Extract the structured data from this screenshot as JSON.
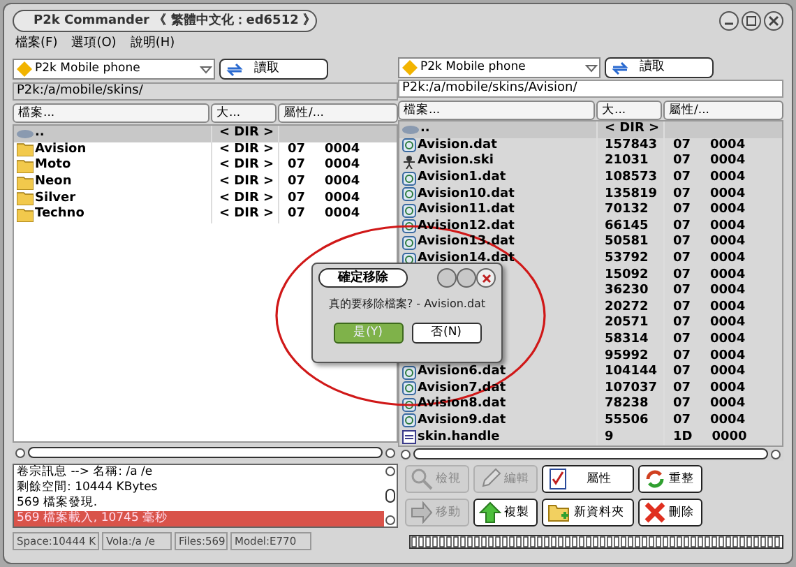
{
  "window": {
    "title": "P2k Commander 《 繁體中文化：ed6512 》"
  },
  "menu": [
    {
      "label": "檔案(F)"
    },
    {
      "label": "選項(O)"
    },
    {
      "label": "說明(H)"
    }
  ],
  "panels": [
    {
      "active": true,
      "device": "P2k Mobile phone",
      "read_button": "讀取",
      "path": "P2k:/a/mobile/skins/",
      "columns": [
        "檔案...",
        "大...",
        "屬性/..."
      ],
      "rows": [
        {
          "kind": "up",
          "name": "..",
          "size": "< DIR >"
        },
        {
          "kind": "folder",
          "name": "Avision",
          "size": "< DIR >",
          "attr": "07",
          "attr2": "0004"
        },
        {
          "kind": "folder",
          "name": "Moto",
          "size": "< DIR >",
          "attr": "07",
          "attr2": "0004"
        },
        {
          "kind": "folder",
          "name": "Neon",
          "size": "< DIR >",
          "attr": "07",
          "attr2": "0004"
        },
        {
          "kind": "folder",
          "name": "Silver",
          "size": "< DIR >",
          "attr": "07",
          "attr2": "0004"
        },
        {
          "kind": "folder",
          "name": "Techno",
          "size": "< DIR >",
          "attr": "07",
          "attr2": "0004"
        }
      ]
    },
    {
      "active": false,
      "device": "P2k Mobile phone",
      "read_button": "讀取",
      "path": "P2k:/a/mobile/skins/Avision/",
      "columns": [
        "檔案...",
        "大...",
        "屬性/..."
      ],
      "rows": [
        {
          "kind": "up",
          "name": "..",
          "size": "< DIR >"
        },
        {
          "kind": "dat",
          "name": "Avision.dat",
          "size": "157843",
          "attr": "07",
          "attr2": "0004"
        },
        {
          "kind": "ski",
          "name": "Avision.ski",
          "size": "21031",
          "attr": "07",
          "attr2": "0004"
        },
        {
          "kind": "dat",
          "name": "Avision1.dat",
          "size": "108573",
          "attr": "07",
          "attr2": "0004"
        },
        {
          "kind": "dat",
          "name": "Avision10.dat",
          "size": "135819",
          "attr": "07",
          "attr2": "0004"
        },
        {
          "kind": "dat",
          "name": "Avision11.dat",
          "size": "70132",
          "attr": "07",
          "attr2": "0004"
        },
        {
          "kind": "dat",
          "name": "Avision12.dat",
          "size": "66145",
          "attr": "07",
          "attr2": "0004"
        },
        {
          "kind": "dat",
          "name": "Avision13.dat",
          "size": "50581",
          "attr": "07",
          "attr2": "0004"
        },
        {
          "kind": "dat",
          "name": "Avision14.dat",
          "size": "53792",
          "attr": "07",
          "attr2": "0004"
        },
        {
          "kind": "hidden",
          "size": "15092",
          "attr": "07",
          "attr2": "0004"
        },
        {
          "kind": "hidden",
          "size": "36230",
          "attr": "07",
          "attr2": "0004"
        },
        {
          "kind": "hidden",
          "size": "20272",
          "attr": "07",
          "attr2": "0004"
        },
        {
          "kind": "hidden",
          "size": "20571",
          "attr": "07",
          "attr2": "0004"
        },
        {
          "kind": "hidden",
          "size": "58314",
          "attr": "07",
          "attr2": "0004"
        },
        {
          "kind": "hidden",
          "size": "95992",
          "attr": "07",
          "attr2": "0004"
        },
        {
          "kind": "dat",
          "name": "Avision6.dat",
          "size": "104144",
          "attr": "07",
          "attr2": "0004"
        },
        {
          "kind": "dat",
          "name": "Avision7.dat",
          "size": "107037",
          "attr": "07",
          "attr2": "0004"
        },
        {
          "kind": "dat",
          "name": "Avision8.dat",
          "size": "78238",
          "attr": "07",
          "attr2": "0004"
        },
        {
          "kind": "dat",
          "name": "Avision9.dat",
          "size": "55506",
          "attr": "07",
          "attr2": "0004"
        },
        {
          "kind": "handle",
          "name": "skin.handle",
          "size": "9",
          "attr": "1D",
          "attr2": "0000"
        }
      ]
    }
  ],
  "log": [
    {
      "text": "卷宗訊息 --> 名稱: /a /e",
      "selected": false
    },
    {
      "text": "剩餘空間: 10444 KBytes",
      "selected": false
    },
    {
      "text": "569 檔案發現.",
      "selected": false
    },
    {
      "text": "569 檔案載入, 10745 毫秒",
      "selected": true
    }
  ],
  "actions": [
    {
      "kind": "view",
      "label": "檢視",
      "disabled": true
    },
    {
      "kind": "edit",
      "label": "編輯",
      "disabled": true
    },
    {
      "kind": "props",
      "label": "屬性",
      "disabled": false
    },
    {
      "kind": "refresh",
      "label": "重整",
      "disabled": false
    },
    {
      "kind": "move",
      "label": "移動",
      "disabled": true
    },
    {
      "kind": "copy",
      "label": "複製",
      "disabled": false
    },
    {
      "kind": "newfolder",
      "label": "新資料夾",
      "disabled": false
    },
    {
      "kind": "delete",
      "label": "刪除",
      "disabled": false
    }
  ],
  "status_bar": [
    "Space:10444 K",
    "Vola:/a /e",
    "Files:569",
    "Model:E770"
  ],
  "dialog": {
    "title": "確定移除",
    "message": "真的要移除檔案? - Avision.dat",
    "buttons": [
      {
        "label": "是(Y)",
        "selected": true
      },
      {
        "label": "否(N)",
        "selected": false
      }
    ]
  }
}
